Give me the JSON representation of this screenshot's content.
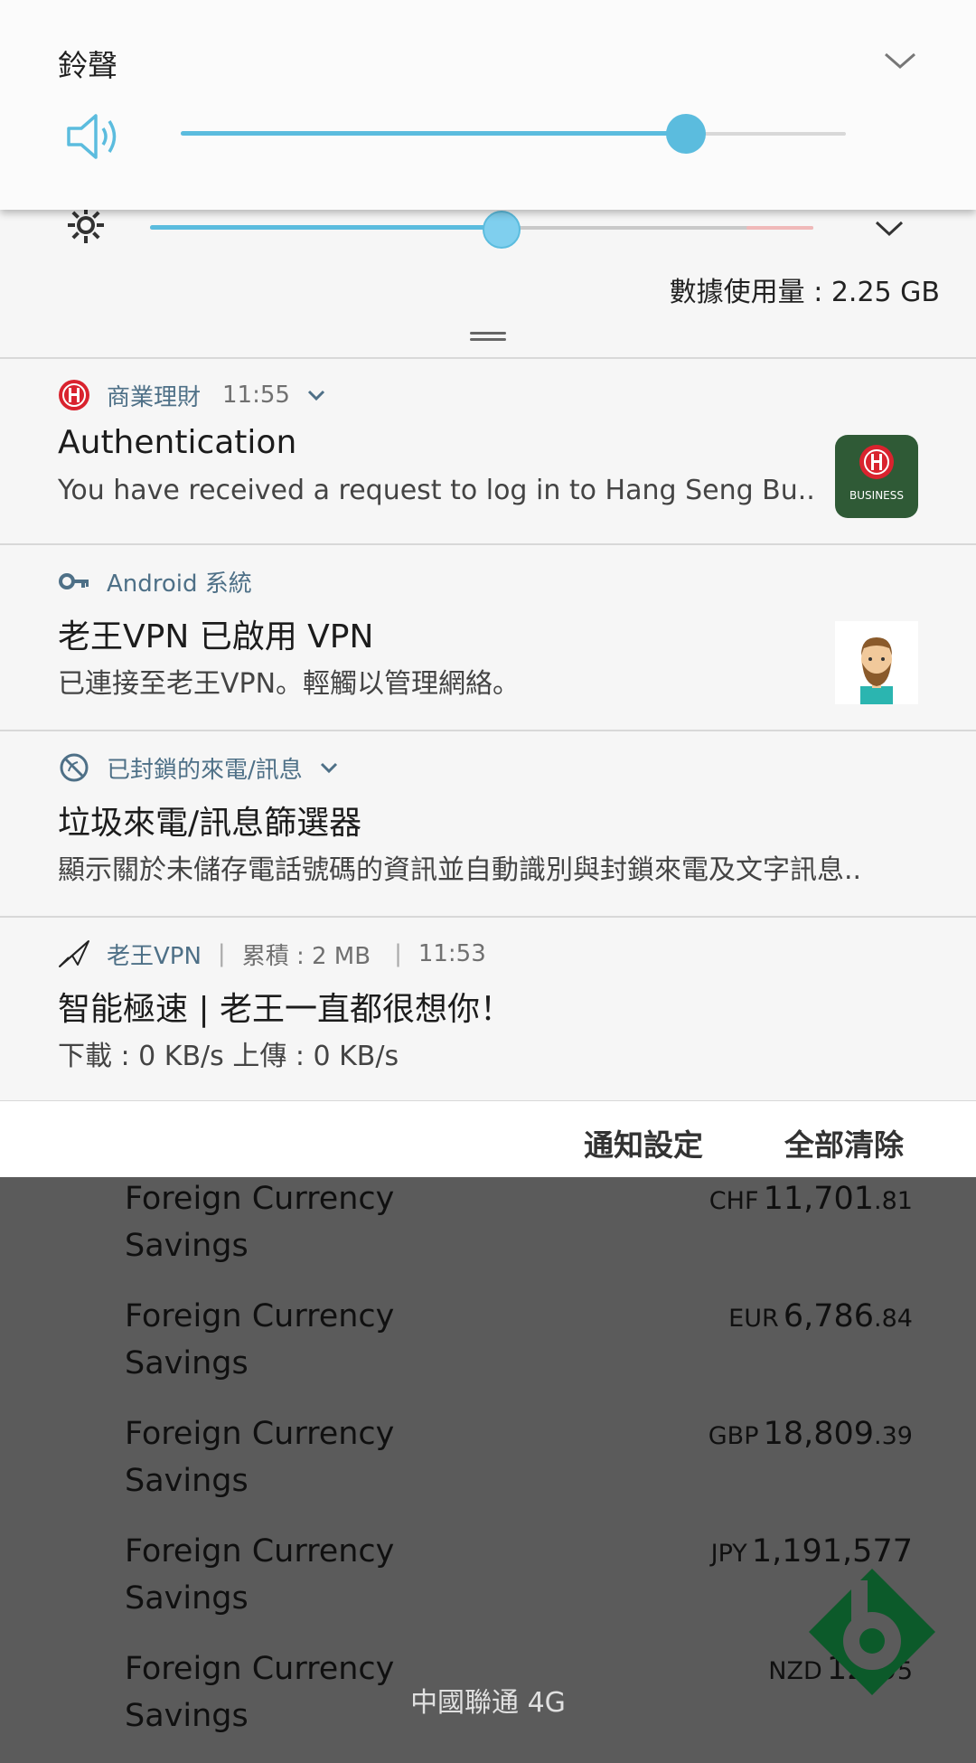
{
  "volume_panel": {
    "title": "鈴聲",
    "level": 0.76
  },
  "brightness": {
    "level": 0.53,
    "data_usage": "數據使用量 : 2.25 GB"
  },
  "notifications": [
    {
      "app": "商業理財",
      "time": "11:55",
      "title": "Authentication",
      "body": "You have received a request to log in to Hang Seng Bu..",
      "thumb_label": "BUSINESS",
      "app_icon": "hang-seng-icon"
    },
    {
      "app": "Android 系統",
      "title": "老王VPN 已啟用 VPN",
      "body": "已連接至老王VPN。輕觸以管理網絡。",
      "app_icon": "key-icon",
      "thumb": "bearded-man-avatar"
    },
    {
      "app": "已封鎖的來電/訊息",
      "title": "垃圾來電/訊息篩選器",
      "body": "顯示關於未儲存電話號碼的資訊並自動識別與封鎖來電及文字訊息..",
      "app_icon": "block-icon"
    },
    {
      "app": "老王VPN",
      "meta": "累積 : 2 MB",
      "time": "11:53",
      "title": "智能極速 | 老王一直都很想你！",
      "body": "下載 : 0 KB/s  上傳 : 0 KB/s",
      "app_icon": "paper-plane-icon"
    }
  ],
  "actions": {
    "settings": "通知設定",
    "clear_all": "全部清除"
  },
  "background_app": {
    "rows": [
      {
        "label": "Foreign Currency Savings",
        "currency": "CHF",
        "integer": "11,701",
        "decimal": ".81"
      },
      {
        "label": "Foreign Currency Savings",
        "currency": "EUR",
        "integer": "6,786",
        "decimal": ".84"
      },
      {
        "label": "Foreign Currency Savings",
        "currency": "GBP",
        "integer": "18,809",
        "decimal": ".39"
      },
      {
        "label": "Foreign Currency Savings",
        "currency": "JPY",
        "integer": "1,191,577",
        "decimal": ""
      },
      {
        "label": "Foreign Currency Savings",
        "currency": "NZD",
        "integer": "12,0",
        "decimal": "5"
      }
    ]
  },
  "carrier": "中國聯通 4G",
  "colors": {
    "accent": "#5bbcde",
    "link_text": "#4e7087",
    "hang_seng_red": "#d9232e",
    "business_green": "#2f5a36",
    "fab_green": "#0c5a2a"
  }
}
